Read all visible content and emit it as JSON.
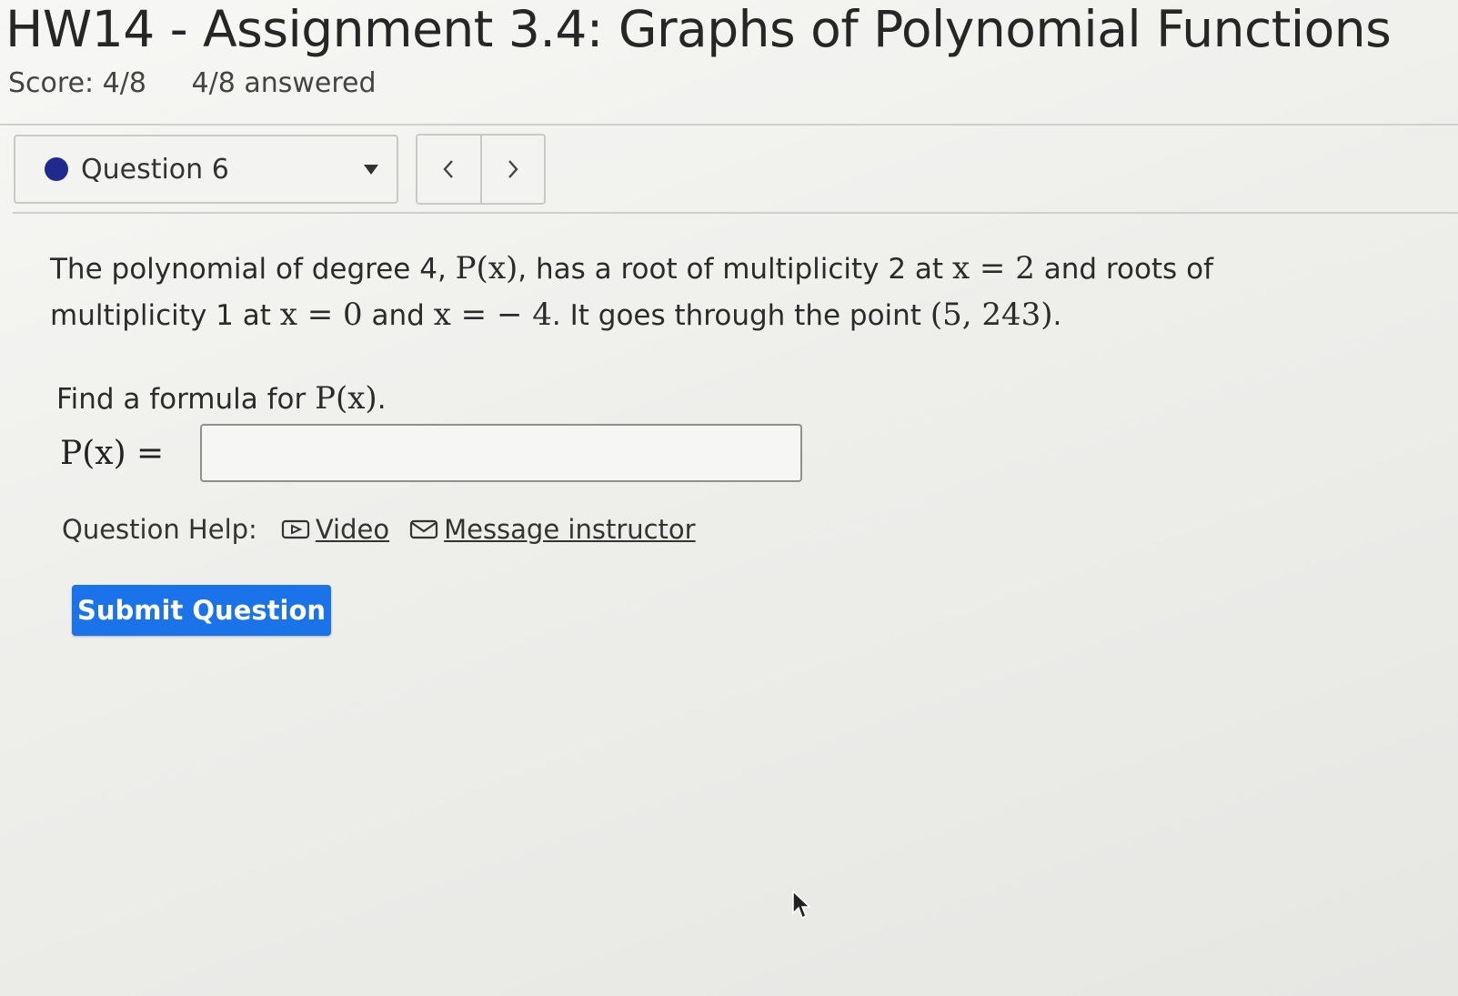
{
  "header": {
    "title": "HW14 - Assignment 3.4: Graphs of Polynomial Functions",
    "score": "Score: 4/8",
    "answered": "4/8 answered"
  },
  "question_nav": {
    "selected": "Question 6",
    "prev_symbol": "<",
    "next_symbol": ">"
  },
  "question": {
    "intro": "The polynomial of degree 4,",
    "p_of_x": "P(x)",
    "part2": ", has a root of multiplicity 2 at",
    "eq_x2": "x = 2",
    "part3": "and roots of multiplicity 1 at",
    "eq_x0": "x = 0",
    "and": "and",
    "eq_xm4": "x = − 4",
    "part4": ". It goes through the point",
    "point": "(5, 243)",
    "end": ".",
    "find_prefix": "Find a formula for",
    "find_p": "P(x)",
    "find_end": ".",
    "answer_label": "P(x) =",
    "answer_value": ""
  },
  "help": {
    "label": "Question Help:",
    "video": "Video",
    "message": "Message instructor"
  },
  "actions": {
    "submit": "Submit Question"
  },
  "colors": {
    "status_dot": "#1f2a8a",
    "submit_bg": "#1a73e8"
  }
}
